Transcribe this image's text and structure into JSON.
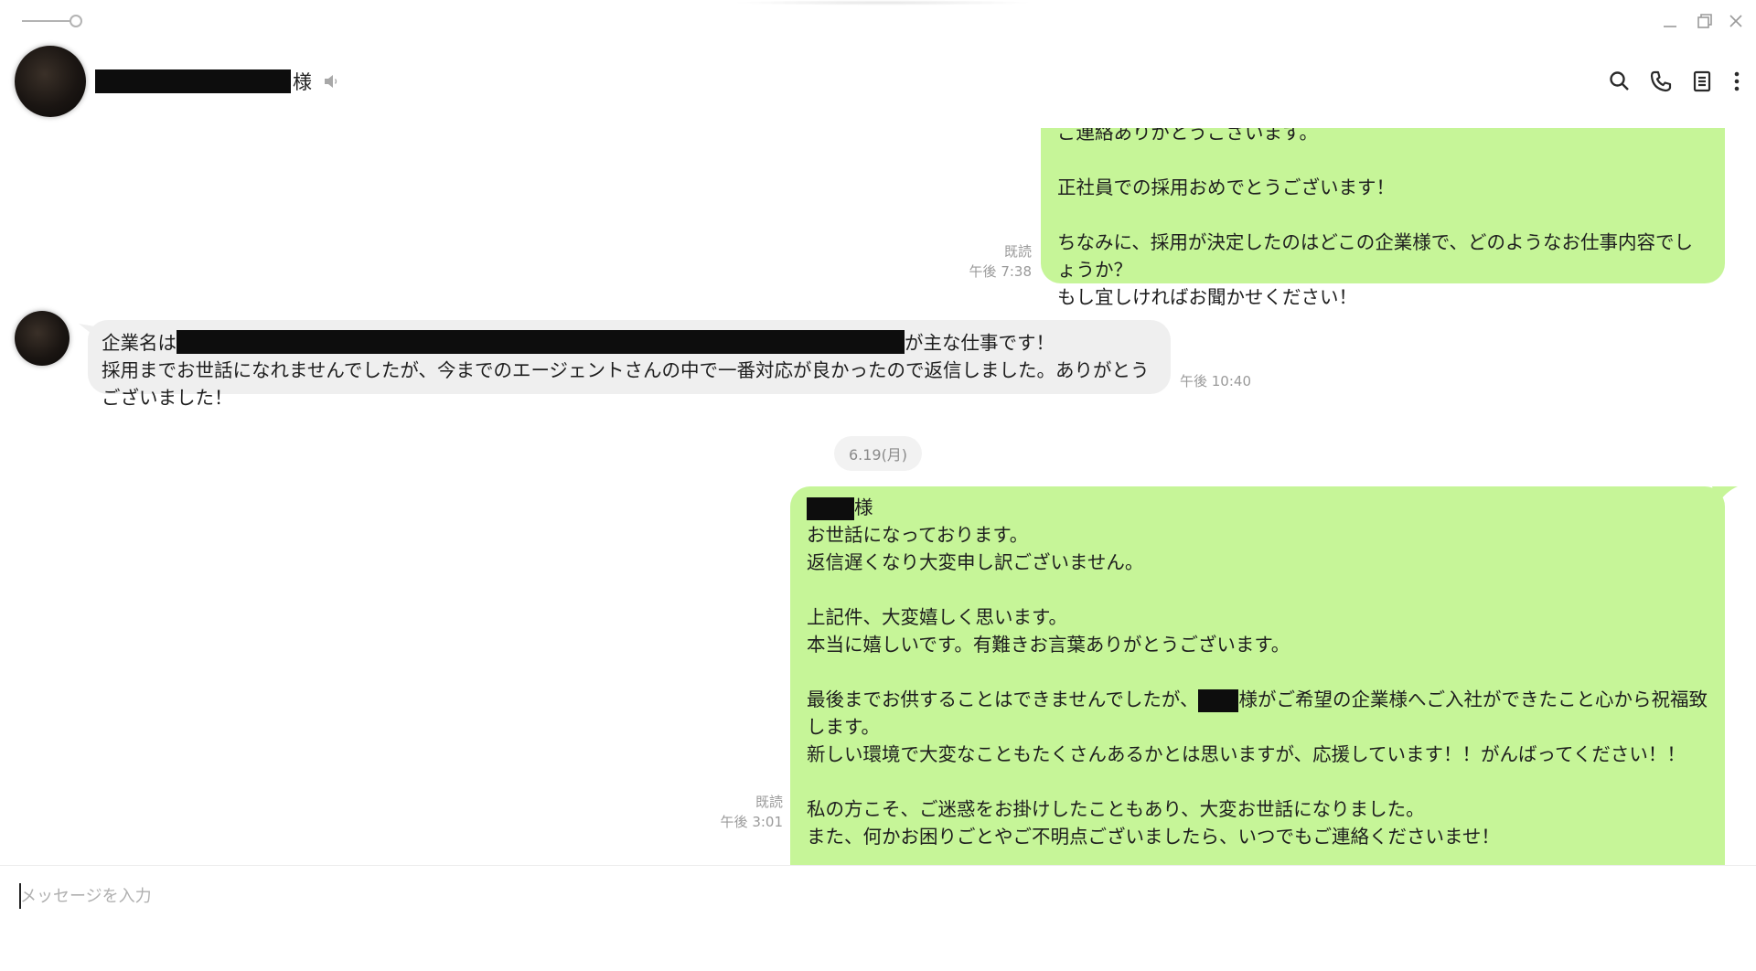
{
  "header": {
    "contact_suffix": "様",
    "icons": [
      "mute-speaker-icon",
      "search-icon",
      "phone-icon",
      "notes-icon",
      "more-vertical-icon"
    ]
  },
  "messages": [
    {
      "direction": "outgoing",
      "lines": [
        "ご連絡ありがとうございます。",
        "",
        "正社員での採用おめでとうございます！",
        "",
        "ちなみに、採用が決定したのはどこの企業様で、どのようなお仕事内容でしょうか？",
        "もし宜しければお聞かせください！"
      ],
      "read": "既読",
      "time": "午後 7:38"
    },
    {
      "direction": "incoming",
      "line1_prefix": "企業名は",
      "line1_suffix": "が主な仕事です！",
      "line2": "採用までお世話になれませんでしたが、今までのエージェントさんの中で一番対応が良かったので返信しました。ありがとうございました！",
      "time": "午後 10:40"
    },
    {
      "direction": "outgoing",
      "name_suffix": "様",
      "lines_a": "お世話になっております。\n返信遅くなり大変申し訳ございません。\n\n上記件、大変嬉しく思います。\n本当に嬉しいです。有難きお言葉ありがとうございます。\n\n最後までお供することはできませんでしたが、",
      "inline_name_suffix": "様がご希望の企業様へご入社ができたこと心から祝福致します。",
      "lines_b": "新しい環境で大変なこともたくさんあるかとは思いますが、応援しています！！がんばってください！！\n\n私の方こそ、ご迷惑をお掛けしたこともあり、大変お世話になりました。\nまた、何かお困りごとやご不明点ございましたら、いつでもご連絡くださいませ！",
      "read": "既読",
      "time": "午後 3:01"
    }
  ],
  "date_separator": "6.19(月)",
  "input": {
    "placeholder": "メッセージを入力",
    "value": ""
  },
  "colors": {
    "outgoing_bubble": "#c6f598",
    "incoming_bubble": "#efefef",
    "meta_text": "#9a9a9a"
  }
}
